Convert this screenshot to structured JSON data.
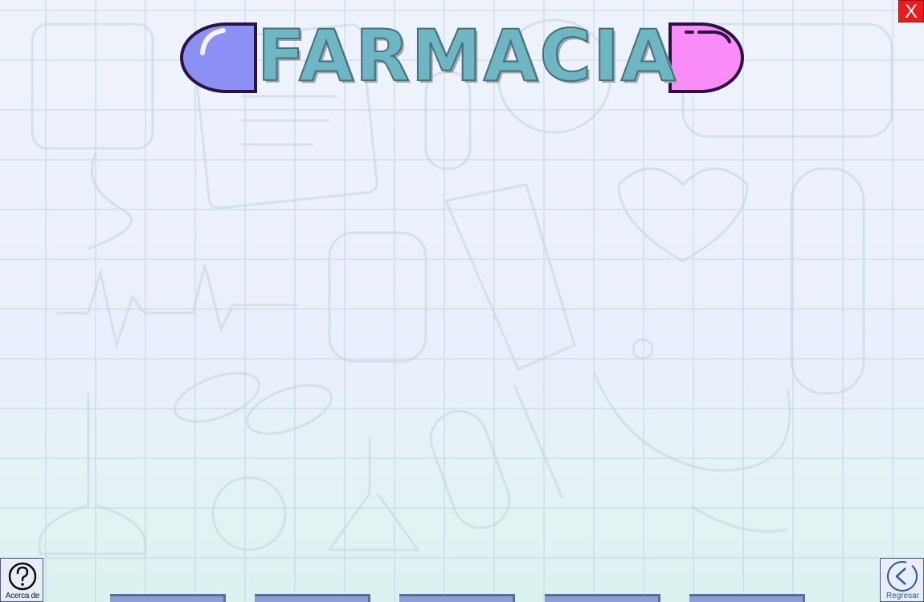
{
  "app": {
    "title": "FARMACIA"
  },
  "window": {
    "close_label": "X"
  },
  "footer": {
    "about_label": "Acerca de",
    "back_label": "Regresar",
    "tabs": [
      "",
      "",
      "",
      "",
      ""
    ]
  },
  "colors": {
    "close_red": "#e81d1d",
    "title_teal": "#6fb6c4",
    "pill_left": "#8c90f5",
    "pill_right": "#f98cf6",
    "tab_blue": "#8a9ed8"
  }
}
